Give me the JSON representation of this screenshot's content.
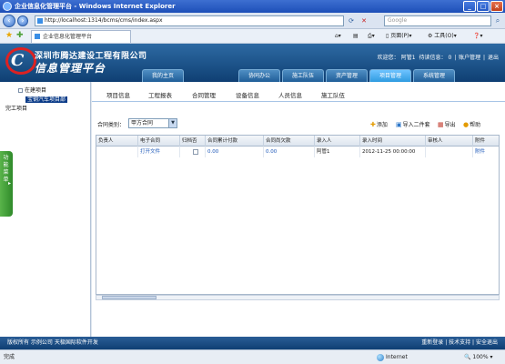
{
  "window": {
    "title": "企业信息化管理平台 - Windows Internet Explorer"
  },
  "browser": {
    "url": "http://localhost:1314/bcms/cms/index.aspx",
    "search_placeholder": "Google",
    "tab_title": "企业信息化管理平台",
    "commands": {
      "page": "页面(P)",
      "tools": "工具(O)"
    }
  },
  "app": {
    "company_name": "深圳市腾达建设工程有限公司",
    "platform_name": "信息管理平台",
    "user": {
      "welcome": "欢迎您：",
      "name": "阿管1",
      "messages": "待读信息：",
      "messages_count": "0",
      "account_link": "账户管理",
      "exit_link": "退出"
    },
    "nav_tabs": [
      "我的主页",
      "协同办公",
      "施工队伍",
      "资产管理",
      "项目管理",
      "系统管理"
    ],
    "active_nav_index": 4
  },
  "sidebar": {
    "items": [
      {
        "label": "在建项目"
      },
      {
        "label": "宝钢汽车项目部"
      },
      {
        "label": "完工项目"
      }
    ],
    "handle_label": "功能菜单"
  },
  "content": {
    "subnav": [
      "项目信息",
      "工程报表",
      "合同管理",
      "设备信息",
      "人员信息",
      "施工队伍"
    ],
    "filter": {
      "label": "合同类别：",
      "selected": "甲方合同"
    },
    "actions": {
      "add": "添加",
      "import": "导入二件套",
      "export": "导出",
      "help": "帮助"
    },
    "table": {
      "headers": [
        "负责人",
        "电子合同",
        "归档否",
        "合同累计付款",
        "合同尚欠款",
        "录入人",
        "录入时间",
        "审核人",
        "附件"
      ],
      "rows": [
        [
          "",
          "打开文件",
          "",
          "0.00",
          "0.00",
          "阿管1",
          "2012-11-25 00:00:00",
          "",
          "附件"
        ]
      ]
    }
  },
  "footer": {
    "left": "版权所有 示例公司 天极国际软件开发",
    "links": [
      "重新登录",
      "技术支持",
      "安全退出"
    ]
  },
  "status": {
    "text": "完成",
    "zone": "Internet",
    "zoom": "100%"
  }
}
